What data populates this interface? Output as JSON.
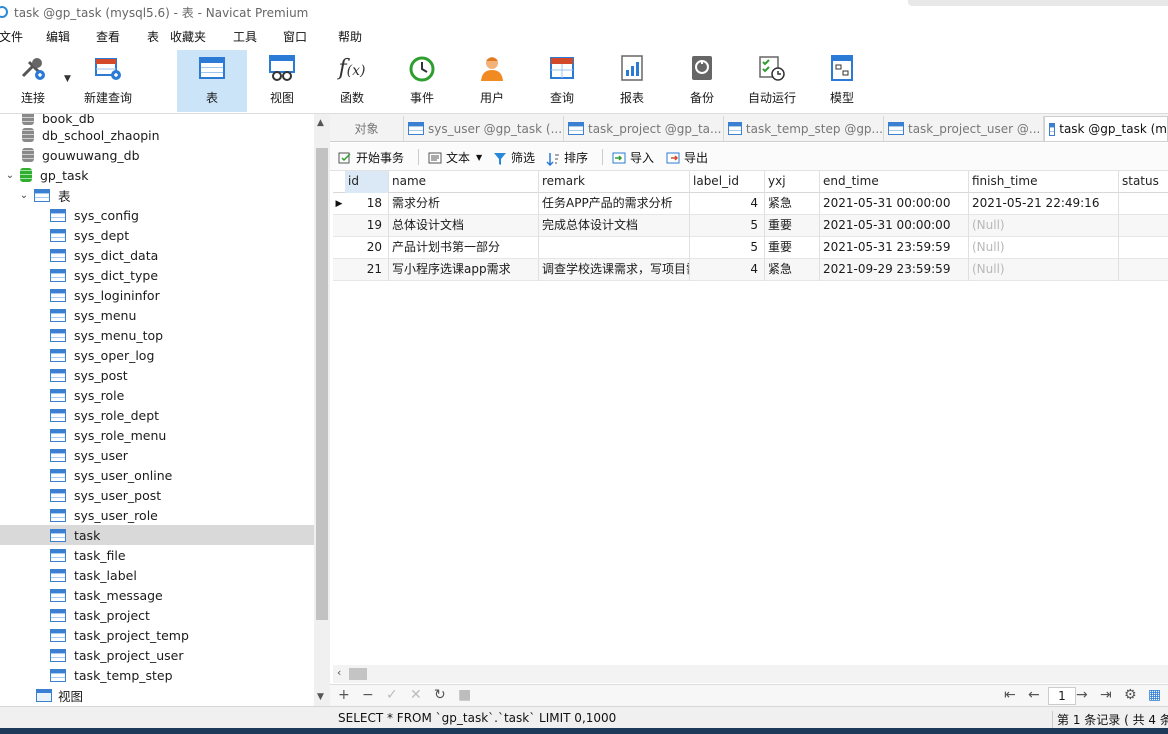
{
  "window": {
    "title": "task @gp_task (mysql5.6) - 表 - Navicat Premium"
  },
  "menu": [
    "文件",
    "编辑",
    "查看",
    "表",
    "收藏夹",
    "工具",
    "窗口",
    "帮助"
  ],
  "toolbar": [
    "连接",
    "新建查询",
    "表",
    "视图",
    "函数",
    "事件",
    "用户",
    "查询",
    "报表",
    "备份",
    "自动运行",
    "模型"
  ],
  "tree": {
    "databases": [
      "book_db",
      "db_school_zhaopin",
      "gouwuwang_db",
      "gp_task"
    ],
    "tables_folder": "表",
    "tables": [
      "sys_config",
      "sys_dept",
      "sys_dict_data",
      "sys_dict_type",
      "sys_logininfor",
      "sys_menu",
      "sys_menu_top",
      "sys_oper_log",
      "sys_post",
      "sys_role",
      "sys_role_dept",
      "sys_role_menu",
      "sys_user",
      "sys_user_online",
      "sys_user_post",
      "sys_user_role",
      "task",
      "task_file",
      "task_label",
      "task_message",
      "task_project",
      "task_project_temp",
      "task_project_user",
      "task_temp_step"
    ],
    "views_folder": "视图"
  },
  "tabs": [
    "对象",
    "sys_user @gp_task (...",
    "task_project @gp_ta...",
    "task_temp_step @gp...",
    "task_project_user @...",
    "task @gp_task (m"
  ],
  "subtoolbar": [
    "开始事务",
    "文本",
    "筛选",
    "排序",
    "导入",
    "导出"
  ],
  "grid": {
    "columns": [
      "id",
      "name",
      "remark",
      "label_id",
      "yxj",
      "end_time",
      "finish_time",
      "status"
    ],
    "rows": [
      [
        "18",
        "需求分析",
        "任务APP产品的需求分析",
        "4",
        "紧急",
        "2021-05-31 00:00:00",
        "2021-05-21 22:49:16",
        ""
      ],
      [
        "19",
        "总体设计文档",
        "完成总体设计文档",
        "5",
        "重要",
        "2021-05-31 00:00:00",
        "(Null)",
        ""
      ],
      [
        "20",
        "产品计划书第一部分",
        "",
        "5",
        "重要",
        "2021-05-31 23:59:59",
        "(Null)",
        ""
      ],
      [
        "21",
        "写小程序选课app需求",
        "调查学校选课需求，写项目需",
        "4",
        "紧急",
        "2021-09-29 23:59:59",
        "(Null)",
        ""
      ]
    ]
  },
  "pagination": {
    "page": "1"
  },
  "status": {
    "sql": "SELECT * FROM `gp_task`.`task` LIMIT 0,1000",
    "records": "第 1 条记录 ( 共 4 条"
  }
}
